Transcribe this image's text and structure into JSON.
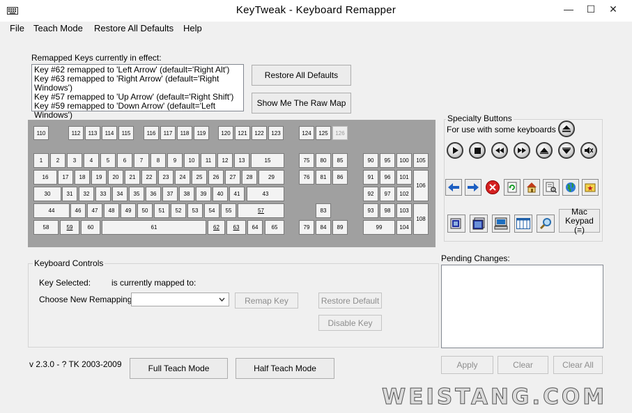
{
  "window": {
    "title": "KeyTweak -  Keyboard Remapper",
    "min_glyph": "—",
    "max_glyph": "☐",
    "close_glyph": "✕"
  },
  "menu": [
    "File",
    "Teach Mode",
    "Restore All Defaults",
    "Help"
  ],
  "remapped": {
    "label": "Remapped Keys currently in effect:",
    "items": [
      "Key #62 remapped to 'Left Arrow' (default='Right Alt')",
      "Key #63 remapped to 'Right Arrow' (default='Right Windows')",
      "Key #57 remapped to 'Up Arrow' (default='Right Shift')",
      "Key #59 remapped to 'Down Arrow' (default='Left Windows')"
    ],
    "restore_all_label": "Restore All Defaults",
    "raw_map_label": "Show Me The Raw Map"
  },
  "keyboard": {
    "disabled_keys": [
      "126"
    ],
    "underlined_keys": [
      "57",
      "59",
      "62",
      "63"
    ]
  },
  "specialty": {
    "title": "Specialty Buttons",
    "subtitle": "For use with some keyboards",
    "mac_keypad_label": "Mac\nKeypad (=)"
  },
  "pending": {
    "label": "Pending Changes:"
  },
  "controls": {
    "title": "Keyboard Controls",
    "key_selected_label": "Key Selected:",
    "mapped_to_label": "is currently mapped to:",
    "choose_label": "Choose New Remapping",
    "select_value": "",
    "remap_key_label": "Remap Key",
    "restore_default_label": "Restore Default",
    "disable_key_label": "Disable Key"
  },
  "footer": {
    "version": "v 2.3.0 - ? TK 2003-2009",
    "full_teach_label": "Full Teach Mode",
    "half_teach_label": "Half Teach Mode",
    "apply_label": "Apply",
    "clear_label": "Clear",
    "clear_all_label": "Clear All"
  },
  "watermark": "WEISTANG.COM",
  "colors": {
    "keyboard_bg": "#a0a0a0",
    "red_circle": "#d42020",
    "arrow_blue": "#1d5fc2"
  }
}
